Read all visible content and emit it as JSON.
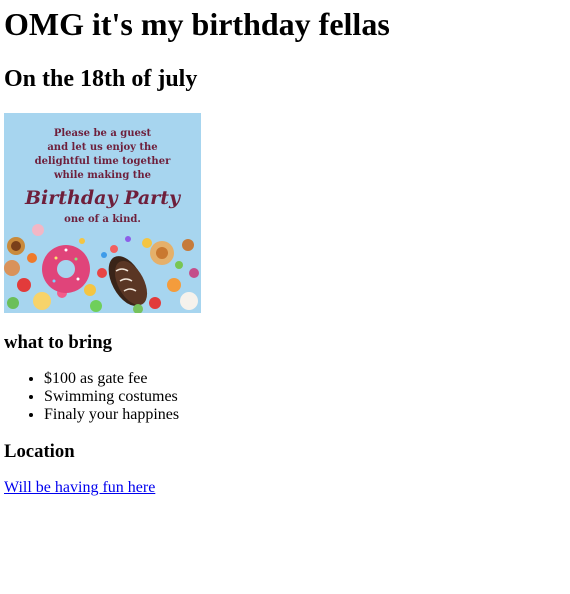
{
  "heading": "OMG it's my birthday fellas",
  "subheading": "On the 18th of july",
  "invitation_image": {
    "lines": [
      "Please be a guest",
      "and let us enjoy the",
      "delightful time together",
      "while making the"
    ],
    "script_text": "Birthday Party",
    "last_line": "one of a kind.",
    "colors": {
      "background": "#a7d5ef",
      "text": "#6e1f3b"
    }
  },
  "bring_section": {
    "title": "what to bring",
    "items": [
      "$100 as gate fee",
      "Swimming costumes",
      "Finaly your happines"
    ]
  },
  "location_section": {
    "title": "Location",
    "link_text": "Will be having fun here"
  },
  "colors": {
    "link": "#0000ee",
    "text": "#000000",
    "background": "#ffffff"
  }
}
